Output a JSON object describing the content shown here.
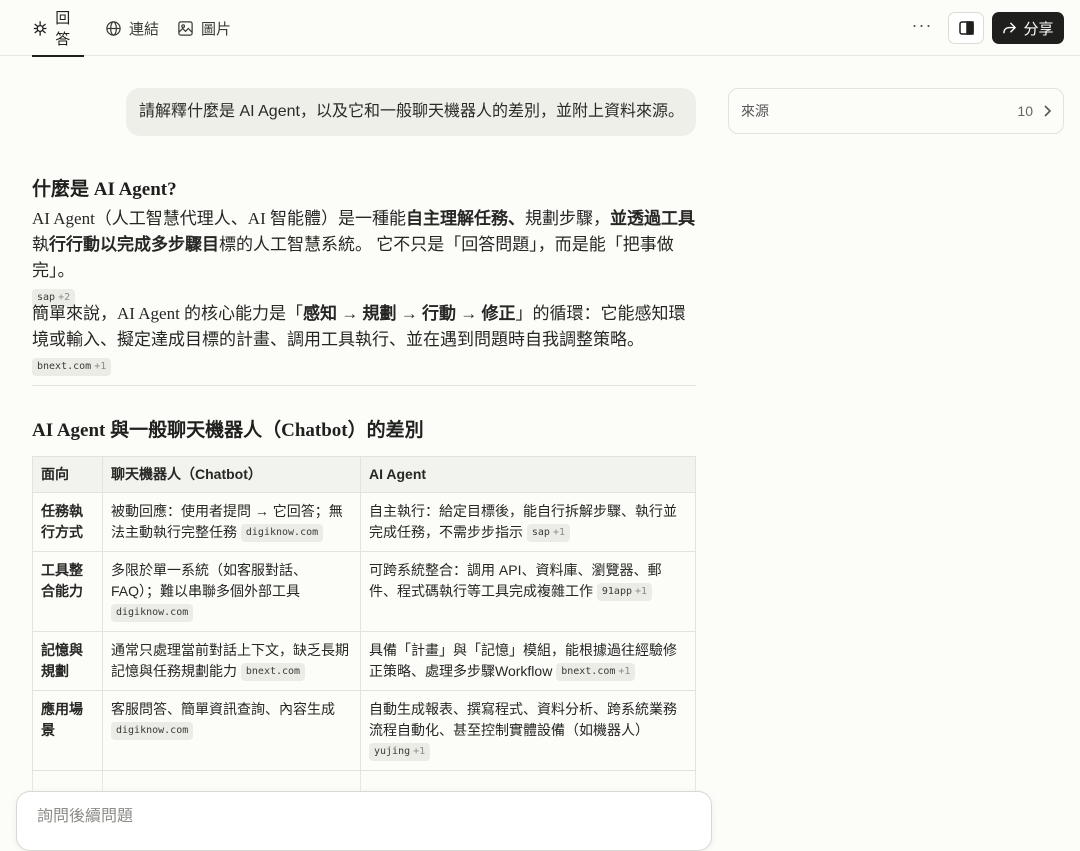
{
  "tabs": [
    {
      "label": "回答",
      "icon": "answer-spark-icon"
    },
    {
      "label": "連結",
      "icon": "globe-icon"
    },
    {
      "label": "圖片",
      "icon": "image-icon"
    }
  ],
  "toolbar": {
    "more": "···",
    "share_label": "分享"
  },
  "question": "請解釋什麼是 AI Agent，以及它和一般聊天機器人的差別，並附上資料來源。",
  "sources": {
    "label": "來源",
    "count": "10"
  },
  "section1": {
    "heading": "什麼是 AI Agent?",
    "p1_a": "AI Agent（人工智慧代理人、AI 智能體）是一種能",
    "p1_b1": "自主理解任務、",
    "p1_c": "規劃步驟，",
    "p1_b2": "並透過工具",
    "p1_d": "執",
    "p1_b3": "行行動以完成多步驟目",
    "p1_e": "標的人工智慧系統。 它不只是「回答問題」，而是能「把事做完」。",
    "p1_cite": {
      "name": "sap",
      "plus": "+2"
    },
    "p2_a": "簡單來說，AI Agent 的核心能力是「",
    "p2_b": "感知 → 規劃 → 行動 → 修正",
    "p2_c": "」的循環：它能感知環境或輸入、擬定達成目標的計畫、調用工具執行、並在遇到問題時自我調整策略。",
    "p2_cite": {
      "name": "bnext.com",
      "plus": "+1"
    }
  },
  "section2": {
    "heading": "AI Agent 與一般聊天機器人（Chatbot）的差別",
    "columns": [
      "面向",
      "聊天機器人（Chatbot）",
      "AI Agent"
    ],
    "rows": [
      {
        "aspect": "任務執行方式",
        "chatbot": "被動回應：使用者提問 → 它回答；無法主動執行完整任務",
        "chatbot_cite": {
          "name": "digiknow.com",
          "plus": ""
        },
        "agent": "自主執行：給定目標後，能自行拆解步驟、執行並完成任務，不需步步指示",
        "agent_cite": {
          "name": "sap",
          "plus": "+1"
        }
      },
      {
        "aspect": "工具整合能力",
        "chatbot": "多限於單一系統（如客服對話、FAQ）；難以串聯多個外部工具",
        "chatbot_cite": {
          "name": "digiknow.com",
          "plus": ""
        },
        "agent": "可跨系統整合：調用 API、資料庫、瀏覽器、郵件、程式碼執行等工具完成複雜工作",
        "agent_cite": {
          "name": "91app",
          "plus": "+1"
        }
      },
      {
        "aspect": "記憶與規劃",
        "chatbot": "通常只處理當前對話上下文，缺乏長期記憶與任務規劃能力",
        "chatbot_cite": {
          "name": "bnext.com",
          "plus": ""
        },
        "agent": "具備「計畫」與「記憶」模組，能根據過往經驗修正策略、處理多步驟Workflow",
        "agent_cite": {
          "name": "bnext.com",
          "plus": "+1"
        }
      },
      {
        "aspect": "應用場景",
        "chatbot": "客服問答、簡單資訊查詢、內容生成",
        "chatbot_cite": {
          "name": "digiknow.com",
          "plus": ""
        },
        "agent": "自動生成報表、撰寫程式、資料分析、跨系統業務流程自動化、甚至控制實體設備（如機器人）",
        "agent_cite": {
          "name": "yujing",
          "plus": "+1"
        }
      }
    ]
  },
  "followup": {
    "placeholder": "詢問後續問題"
  }
}
